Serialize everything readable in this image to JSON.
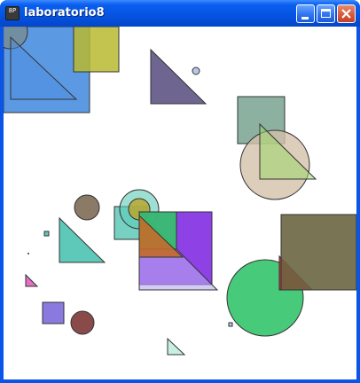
{
  "window": {
    "title": "laboratorio8",
    "icon": "app-icon",
    "icon_text": "8P",
    "buttons": [
      "minimize-icon",
      "maximize-icon",
      "close-icon"
    ]
  },
  "colors": {
    "titlebar": "#0553e0",
    "canvas_background": "#ffffff",
    "blue": "#4a8ee0",
    "olive": "#b8b830",
    "purple_gray": "#6e6690",
    "sage": "#7fa897",
    "beige": "#d4c0aa",
    "light_green": "#9ad86a",
    "teal": "#5ec9b8",
    "brown_gray": "#8a7a66",
    "violet": "#7a20e0",
    "green": "#33c46a",
    "orange_brown": "#c46a2a",
    "olive_dark": "#6a6540",
    "red": "#e03040",
    "pink": "#e070c0",
    "lavender": "#8a7ae0",
    "maroon": "#8a4a4a",
    "mint": "#c8f0e0"
  }
}
